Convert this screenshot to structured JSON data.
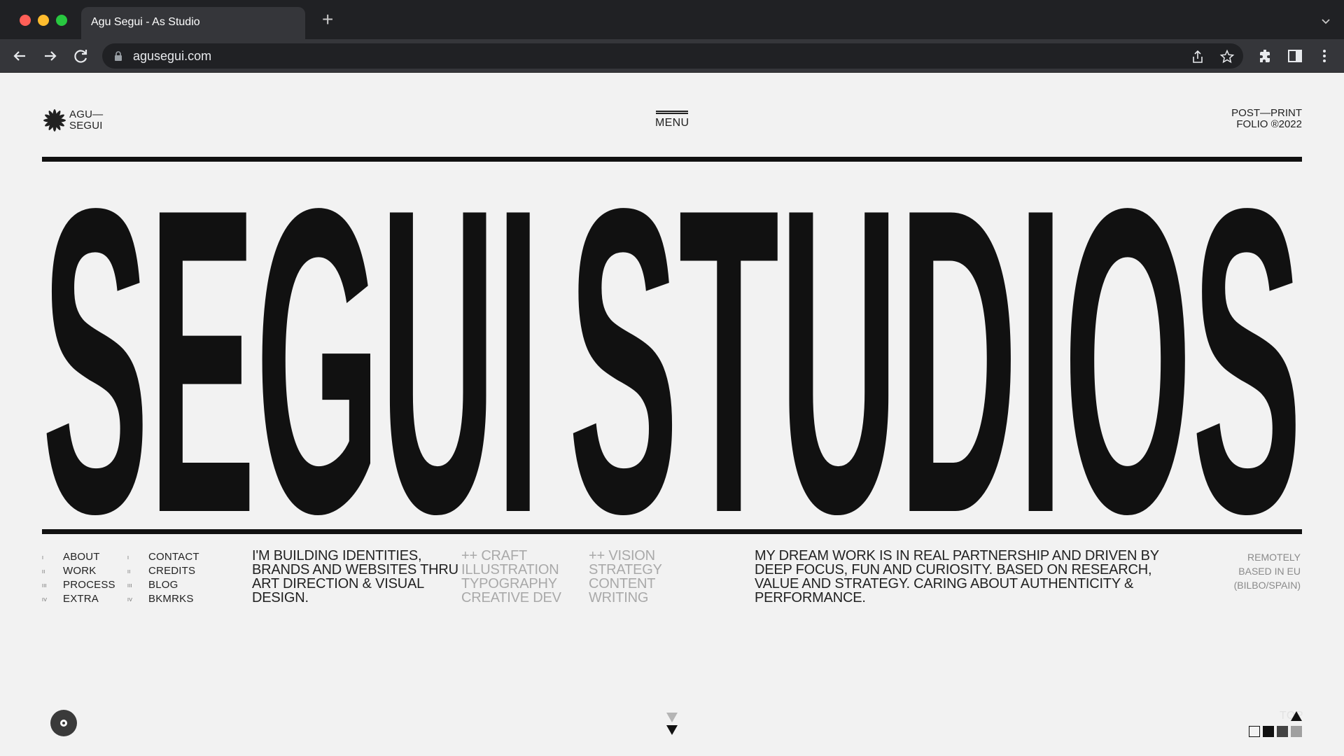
{
  "browser": {
    "tab_title": "Agu Segui - As Studio",
    "new_tab_label": "+",
    "url": "agusegui.com"
  },
  "header": {
    "logo_line1": "AGU—",
    "logo_line2": "SEGUI",
    "menu_label": "MENU",
    "folio_line1": "POST—PRINT",
    "folio_line2": "FOLIO ®2022"
  },
  "headline": {
    "word1": "SEGUI",
    "word2": "STUDIOS"
  },
  "nav": {
    "col1": [
      {
        "numeral": "I",
        "label": "ABOUT"
      },
      {
        "numeral": "II",
        "label": "WORK"
      },
      {
        "numeral": "III",
        "label": "PROCESS"
      },
      {
        "numeral": "IV",
        "label": "EXTRA"
      }
    ],
    "col2": [
      {
        "numeral": "I",
        "label": "CONTACT"
      },
      {
        "numeral": "II",
        "label": "CREDITS"
      },
      {
        "numeral": "III",
        "label": "BLOG"
      },
      {
        "numeral": "IV",
        "label": "BKMRKS"
      }
    ]
  },
  "intro": "I'M BUILDING IDENTITIES, BRANDS AND WEBSITES THRU ART DIRECTION & VISUAL DESIGN.",
  "craft": [
    "++ CRAFT",
    "ILLUSTRATION",
    "TYPOGRAPHY",
    "CREATIVE DEV"
  ],
  "vision": [
    "++ VISION",
    "STRATEGY",
    "CONTENT",
    "WRITING"
  ],
  "dream": "MY DREAM WORK IS IN REAL PARTNERSHIP AND DRIVEN BY DEEP FOCUS, FUN AND CURIOSITY. BASED ON RESEARCH, VALUE AND STRATEGY. CARING ABOUT AUTHENTICITY & PERFORMANCE.",
  "location": [
    "REMOTELY",
    "BASED IN EU",
    "(BILBO/SPAIN)"
  ],
  "footer": {
    "top_label": "TOP",
    "swatch_colors": [
      "#f2f2f2",
      "#111111",
      "#444444",
      "#a0a0a0"
    ]
  }
}
